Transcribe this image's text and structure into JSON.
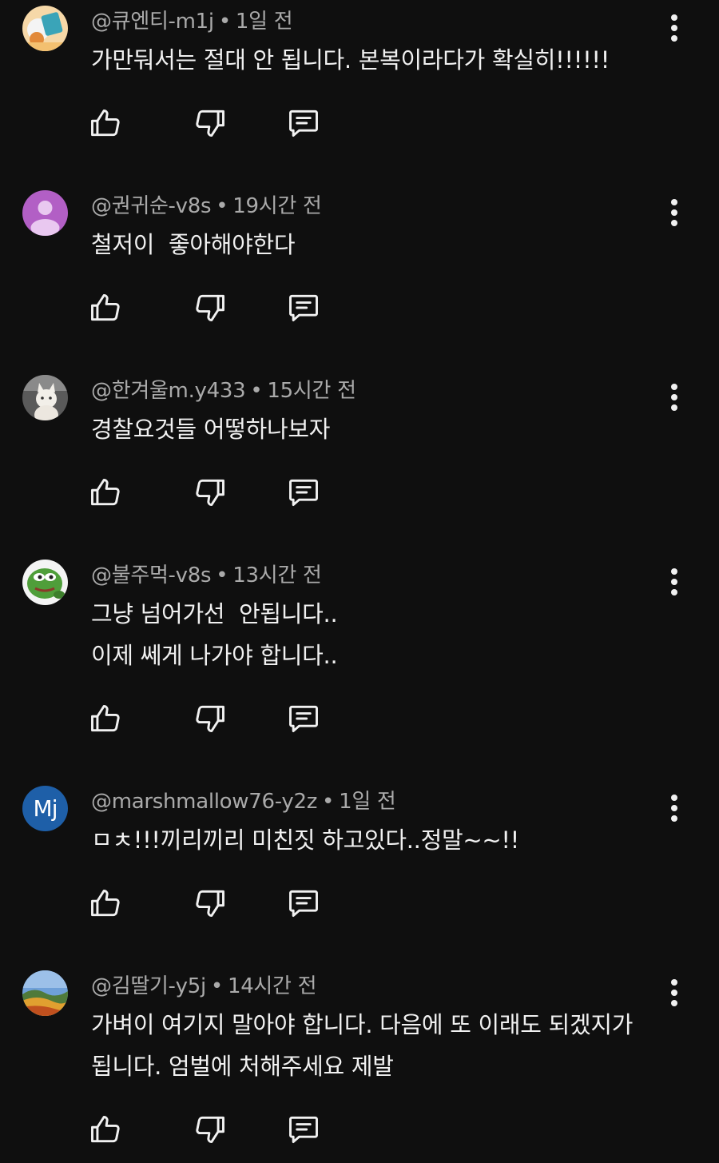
{
  "colors": {
    "background": "#0f0f0f",
    "primary_text": "#f1f1f1",
    "secondary_text": "#aaaaaa"
  },
  "icons": {
    "like": "thumbs-up-icon",
    "dislike": "thumbs-down-icon",
    "reply": "reply-comment-icon",
    "menu": "more-vertical-icon"
  },
  "separator": "•",
  "comments": [
    {
      "author": "@큐엔티-m1j",
      "time": "1일 전",
      "text": "가만둬서는 절대 안 됩니다. 본복이라다가 확실히!!!!!!",
      "avatar": {
        "type": "image",
        "color": "#f0a040"
      }
    },
    {
      "author": "@권귀순-v8s",
      "time": "19시간 전",
      "text": "철저이  좋아해야한다",
      "avatar": {
        "type": "default",
        "color": "#b25fc5"
      }
    },
    {
      "author": "@한겨울m.y433",
      "time": "15시간 전",
      "text": "경찰요것들 어떻하나보자",
      "avatar": {
        "type": "image",
        "color": "#6a6a6a"
      }
    },
    {
      "author": "@불주먹-v8s",
      "time": "13시간 전",
      "text": "그냥 넘어가선  안됩니다..\n이제 쎄게 나가야 합니다..",
      "avatar": {
        "type": "image",
        "color": "#4a9a3a"
      }
    },
    {
      "author": "@marshmallow76-y2z",
      "time": "1일 전",
      "text": "ㅁㅊ!!!끼리끼리 미친짓 하고있다..정말~~!!",
      "avatar": {
        "type": "initials",
        "initials": "Mj",
        "color": "#1e5fa8"
      }
    },
    {
      "author": "@김딸기-y5j",
      "time": "14시간 전",
      "text": "가벼이 여기지 말아야 합니다. 다음에 또 이래도 되겠지가\n됩니다. 엄벌에 처해주세요 제발",
      "avatar": {
        "type": "image",
        "color": "#d89030"
      }
    }
  ]
}
